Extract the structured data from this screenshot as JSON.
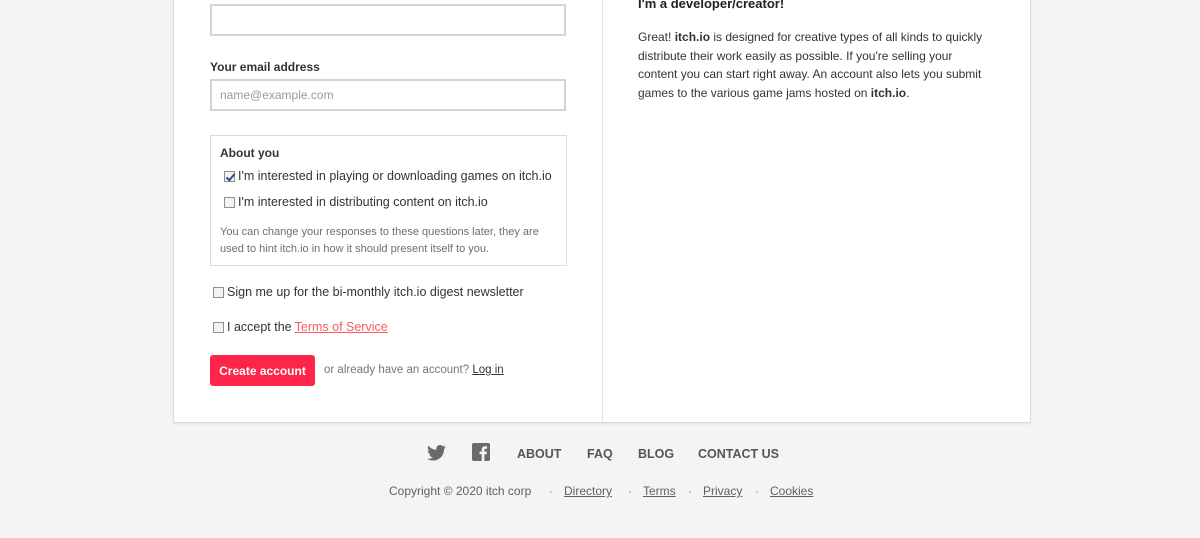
{
  "form": {
    "top_input_value": "",
    "email_label": "Your email address",
    "email_placeholder": "name@example.com",
    "about": {
      "title": "About you",
      "options": [
        {
          "label": "I'm interested in playing or downloading games on itch.io",
          "checked": true
        },
        {
          "label": "I'm interested in distributing content on itch.io",
          "checked": false
        }
      ],
      "help": "You can change your responses to these questions later, they are used to hint itch.io in how it should present itself to you."
    },
    "newsletter_label": "Sign me up for the bi-monthly itch.io digest newsletter",
    "accept_prefix": "I accept the",
    "tos_link": "Terms of Service",
    "create_button": "Create account",
    "login_prompt": "or already have an account?",
    "login_link": "Log in"
  },
  "developer": {
    "heading": "I'm a developer/creator!",
    "body_1": "Great! ",
    "body_brand": "itch.io",
    "body_2": " is designed for creative types of all kinds to quickly distribute their work easily as possible. If you're selling your content you can start right away. An account also lets you submit games to the various game jams hosted on ",
    "body_brand_2": "itch.io",
    "body_end": "."
  },
  "footer": {
    "social": [
      {
        "icon": "twitter-icon"
      },
      {
        "icon": "facebook-icon"
      }
    ],
    "nav": [
      "About",
      "FAQ",
      "Blog",
      "Contact us"
    ],
    "copyright": "Copyright © 2020 itch corp",
    "separator": "·",
    "links": [
      "Directory",
      "Terms",
      "Privacy",
      "Cookies"
    ]
  },
  "colors": {
    "accent": "#ff2449",
    "link_red": "#fa5c5c",
    "page_bg": "#f4f4f4"
  }
}
